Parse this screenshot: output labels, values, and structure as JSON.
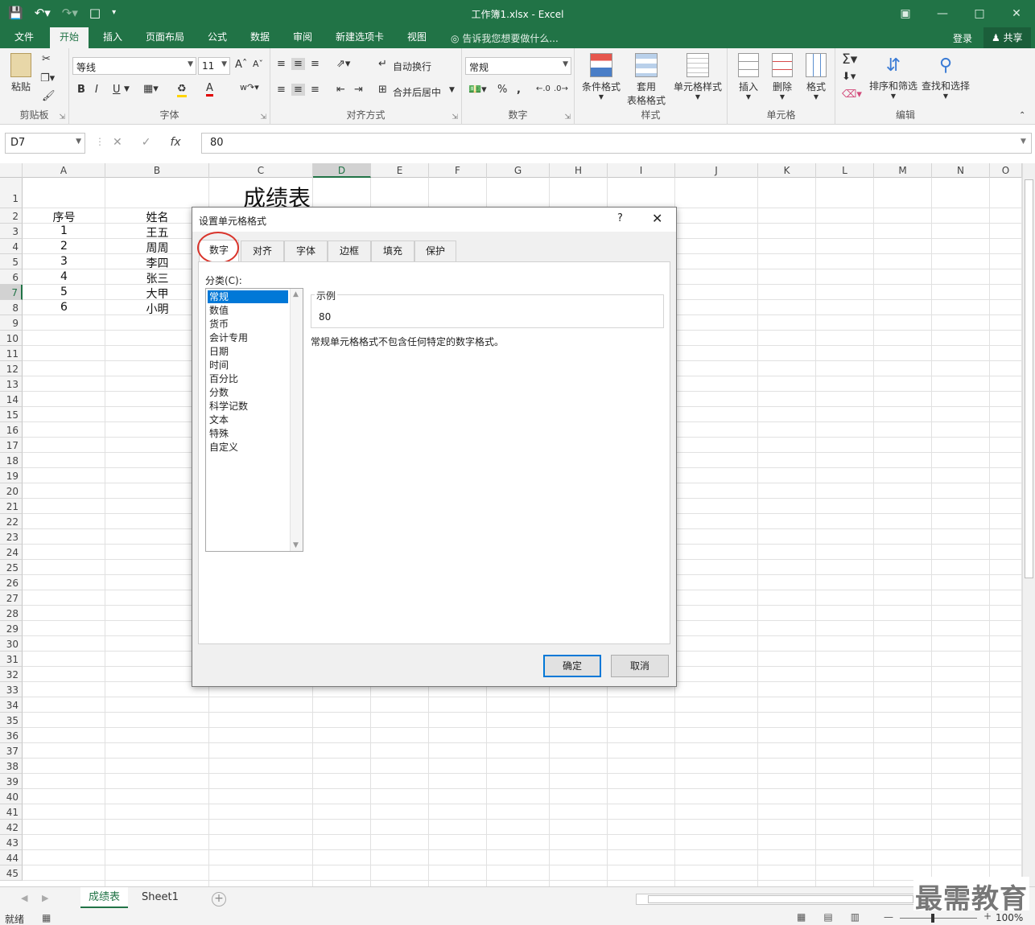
{
  "titlebar": {
    "title": "工作簿1.xlsx - Excel",
    "qat_icons": [
      "save-icon",
      "undo-icon",
      "redo-icon",
      "new-file-icon",
      "customize-icon"
    ],
    "window_icons": [
      "ribbon-options-icon",
      "minimize-icon",
      "maximize-icon",
      "close-icon"
    ]
  },
  "menu": {
    "tabs": [
      "文件",
      "开始",
      "插入",
      "页面布局",
      "公式",
      "数据",
      "审阅",
      "新建选项卡",
      "视图"
    ],
    "active": "开始",
    "tell_me": "告诉我您想要做什么...",
    "login": "登录",
    "share": "共享"
  },
  "ribbon": {
    "groups": [
      "剪贴板",
      "字体",
      "对齐方式",
      "数字",
      "样式",
      "单元格",
      "编辑"
    ],
    "clipboard": {
      "paste": "粘贴"
    },
    "font": {
      "name": "等线",
      "size": "11",
      "bold": "B",
      "italic": "I",
      "underline": "U"
    },
    "alignment": {
      "wrap": "自动换行",
      "merge": "合并后居中"
    },
    "number": {
      "format": "常规",
      "percent": "%",
      "comma": ","
    },
    "styles": {
      "conditional": "条件格式",
      "table1": "套用",
      "table2": "表格格式",
      "cell_styles": "单元格样式"
    },
    "cells": {
      "insert": "插入",
      "delete": "删除",
      "format": "格式"
    },
    "editing": {
      "sort_filter": "排序和筛选",
      "find_select": "查找和选择"
    }
  },
  "formula_bar": {
    "name_box": "D7",
    "content": "80"
  },
  "sheet": {
    "columns": [
      "A",
      "B",
      "C",
      "D",
      "E",
      "F",
      "G",
      "H",
      "I",
      "J",
      "K",
      "L",
      "M",
      "N",
      "O"
    ],
    "selected_column": "D",
    "selected_row": 7,
    "row_count": 45,
    "title": "成绩表",
    "header": {
      "a": "序号",
      "b": "姓名"
    },
    "rows": [
      {
        "no": "1",
        "name": "王五"
      },
      {
        "no": "2",
        "name": "周周"
      },
      {
        "no": "3",
        "name": "李四"
      },
      {
        "no": "4",
        "name": "张三"
      },
      {
        "no": "5",
        "name": "大甲"
      },
      {
        "no": "6",
        "name": "小明"
      }
    ]
  },
  "sheet_tabs": {
    "tabs": [
      "成绩表",
      "Sheet1"
    ],
    "active": "成绩表"
  },
  "watermark": "最需教育",
  "status": {
    "ready": "就绪",
    "zoom": "100%"
  },
  "dialog": {
    "title": "设置单元格格式",
    "help": "?",
    "tabs": [
      "数字",
      "对齐",
      "字体",
      "边框",
      "填充",
      "保护"
    ],
    "active_tab": "数字",
    "category_label": "分类(C):",
    "categories": [
      "常规",
      "数值",
      "货币",
      "会计专用",
      "日期",
      "时间",
      "百分比",
      "分数",
      "科学记数",
      "文本",
      "特殊",
      "自定义"
    ],
    "selected_category": "常规",
    "sample_label": "示例",
    "sample_value": "80",
    "description": "常规单元格格式不包含任何特定的数字格式。",
    "ok": "确定",
    "cancel": "取消"
  }
}
